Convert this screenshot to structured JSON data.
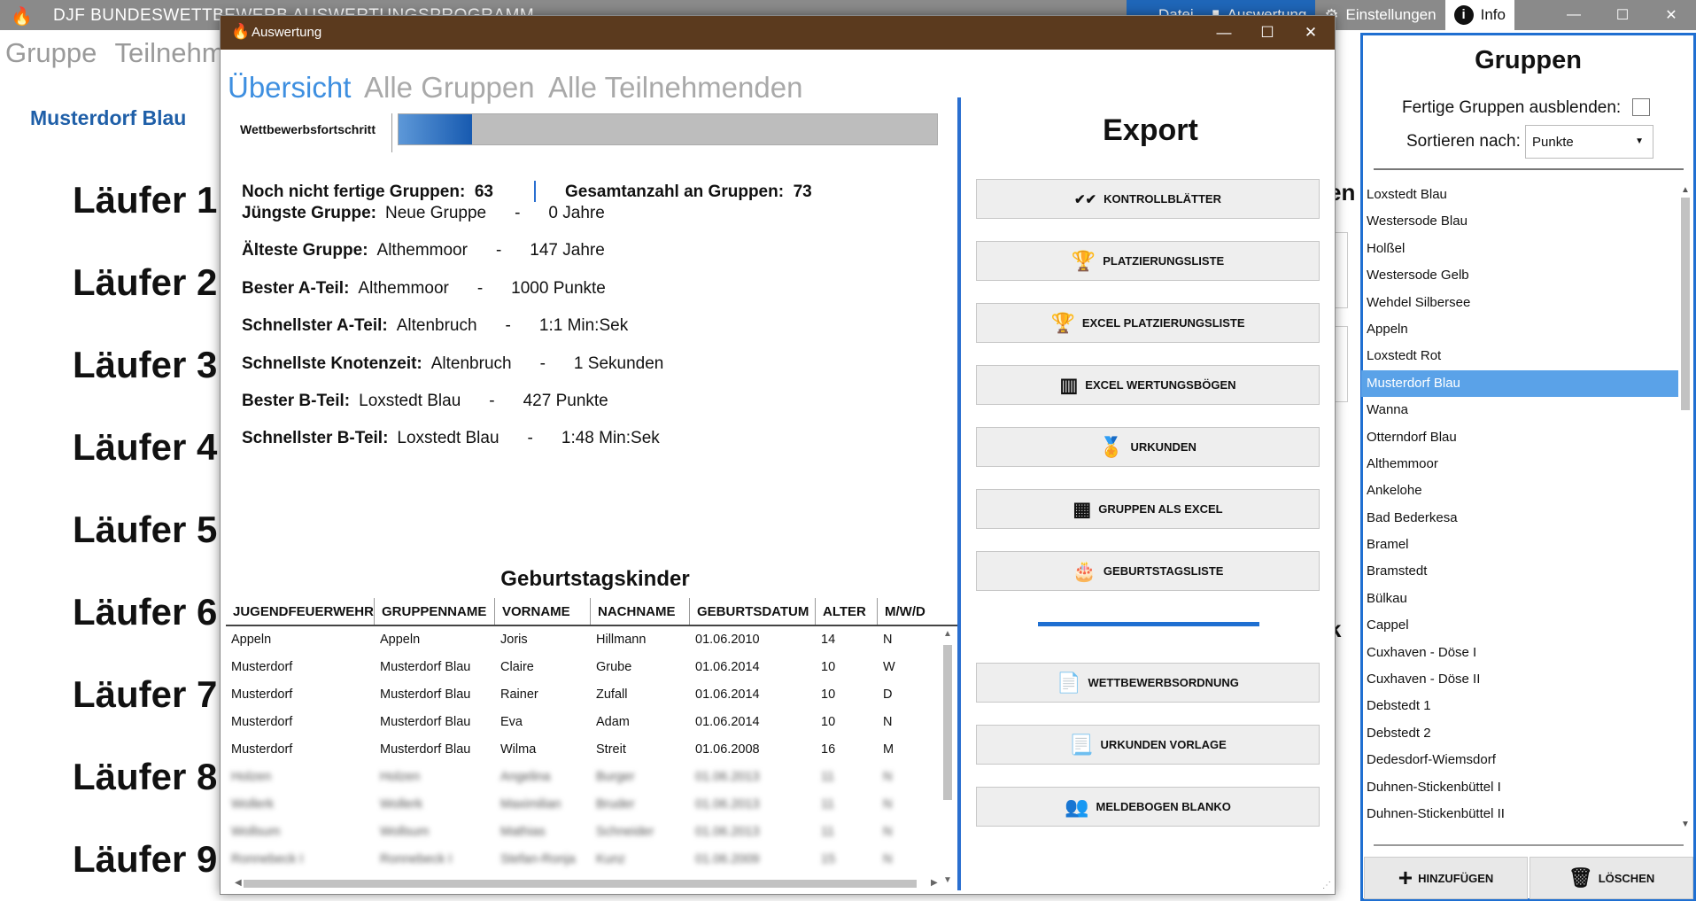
{
  "main_window": {
    "title": "DJF BUNDESWETTBEWERB AUSWERTUNGSPROGRAMM",
    "tabs": [
      {
        "label": "Datei",
        "icon": "folder-icon"
      },
      {
        "label": "Auswertung",
        "icon": "chart-icon"
      },
      {
        "label": "Einstellungen",
        "icon": "gear-icon"
      },
      {
        "label": "Info",
        "icon": "info-icon"
      }
    ],
    "controls": {
      "minimize": "—",
      "maximize": "☐",
      "close": "✕"
    }
  },
  "background": {
    "tabs": [
      "Gruppe",
      "Teilnehmende"
    ],
    "group_name": "Musterdorf Blau",
    "runners": [
      "Läufer 1",
      "Läufer 2",
      "Läufer 3",
      "Läufer 4",
      "Läufer 5",
      "Läufer 6",
      "Läufer 7",
      "Läufer 8",
      "Läufer 9"
    ],
    "side_fragments": [
      "en",
      "k"
    ]
  },
  "gruppen_panel": {
    "title": "Gruppen",
    "hide_finished_label": "Fertige Gruppen ausblenden:",
    "hide_finished_checked": false,
    "sort_label": "Sortieren nach:",
    "sort_value": "Punkte",
    "groups": [
      "Loxstedt Blau",
      "Westersode Blau",
      "Holßel",
      "Westersode Gelb",
      "Wehdel Silbersee",
      "Appeln",
      "Loxstedt Rot",
      "Musterdorf Blau",
      "Wanna",
      "Otterndorf Blau",
      "Althemmoor",
      "Ankelohe",
      "Bad Bederkesa",
      "Bramel",
      "Bramstedt",
      "Bülkau",
      "Cappel",
      "Cuxhaven - Döse I",
      "Cuxhaven - Döse II",
      "Debstedt 1",
      "Debstedt 2",
      "Dedesdorf-Wiemsdorf",
      "Duhnen-Stickenbüttel I",
      "Duhnen-Stickenbüttel II"
    ],
    "selected_group": "Musterdorf Blau",
    "add_button": "HINZUFÜGEN",
    "delete_button": "LÖSCHEN"
  },
  "dialog": {
    "title": "Auswertung",
    "controls": {
      "minimize": "—",
      "maximize": "☐",
      "close": "✕"
    },
    "tabs": [
      "Übersicht",
      "Alle Gruppen",
      "Alle Teilnehmenden"
    ],
    "active_tab": "Übersicht",
    "progress": {
      "label": "Wettbewerbsfortschritt",
      "fraction": 0.137
    },
    "unfinished_label": "Noch nicht fertige Gruppen:",
    "unfinished_value": "63",
    "total_label": "Gesamtanzahl an Gruppen:",
    "total_value": "73",
    "stats": [
      {
        "label": "Jüngste Gruppe:",
        "name": "Neue Gruppe",
        "value": "0 Jahre"
      },
      {
        "label": "Älteste Gruppe:",
        "name": "Althemmoor",
        "value": "147 Jahre"
      },
      {
        "label": "Bester A-Teil:",
        "name": "Althemmoor",
        "value": "1000 Punkte"
      },
      {
        "label": "Schnellster A-Teil:",
        "name": "Altenbruch",
        "value": "1:1 Min:Sek"
      },
      {
        "label": "Schnellste Knotenzeit:",
        "name": "Altenbruch",
        "value": "1 Sekunden"
      },
      {
        "label": "Bester B-Teil:",
        "name": "Loxstedt Blau",
        "value": "427 Punkte"
      },
      {
        "label": "Schnellster B-Teil:",
        "name": "Loxstedt Blau",
        "value": "1:48 Min:Sek"
      }
    ],
    "stat_separator": "-",
    "birthday_title": "Geburtstagskinder",
    "birthday_columns": [
      "JUGENDFEUERWEHR",
      "GRUPPENNAME",
      "VORNAME",
      "NACHNAME",
      "GEBURTSDATUM",
      "ALTER",
      "M/W/D"
    ],
    "birthday_rows": [
      [
        "Appeln",
        "Appeln",
        "Joris",
        "Hillmann",
        "01.06.2010",
        "14",
        "N"
      ],
      [
        "Musterdorf",
        "Musterdorf Blau",
        "Claire",
        "Grube",
        "01.06.2014",
        "10",
        "W"
      ],
      [
        "Musterdorf",
        "Musterdorf Blau",
        "Rainer",
        "Zufall",
        "01.06.2014",
        "10",
        "D"
      ],
      [
        "Musterdorf",
        "Musterdorf Blau",
        "Eva",
        "Adam",
        "01.06.2014",
        "10",
        "N"
      ],
      [
        "Musterdorf",
        "Musterdorf Blau",
        "Wilma",
        "Streit",
        "01.06.2008",
        "16",
        "M"
      ]
    ],
    "blurred_rows": [
      [
        "Holzen",
        "Holzen",
        "Angelina",
        "Burger",
        "01.06.2013",
        "11",
        "N"
      ],
      [
        "Wollerk",
        "Wollerk",
        "Maximilian",
        "Bruder",
        "01.06.2013",
        "11",
        "N"
      ],
      [
        "Wollsum",
        "Wollsum",
        "Mathias",
        "Schneider",
        "01.06.2013",
        "11",
        "N"
      ],
      [
        "Ronnebeck I",
        "Ronnebeck I",
        "Stefan-Ronja",
        "Kunz",
        "01.06.2009",
        "15",
        "N"
      ]
    ],
    "export": {
      "title": "Export",
      "buttons": [
        {
          "label": "KONTROLLBLÄTTER",
          "icon": "double-check-icon"
        },
        {
          "label": "PLATZIERUNGSLISTE",
          "icon": "trophy-icon"
        },
        {
          "label": "EXCEL PLATZIERUNGSLISTE",
          "icon": "trophy-icon"
        },
        {
          "label": "EXCEL WERTUNGSBÖGEN",
          "icon": "abacus-icon"
        },
        {
          "label": "URKUNDEN",
          "icon": "medal-icon"
        },
        {
          "label": "GRUPPEN ALS EXCEL",
          "icon": "excel-icon"
        },
        {
          "label": "GEBURTSTAGSLISTE",
          "icon": "cake-icon"
        }
      ],
      "buttons2": [
        {
          "label": "WETTBEWERBSORDNUNG",
          "icon": "pdf-icon"
        },
        {
          "label": "URKUNDEN VORLAGE",
          "icon": "certificate-file-icon"
        },
        {
          "label": "MELDEBOGEN BLANKO",
          "icon": "add-user-icon"
        }
      ]
    }
  }
}
